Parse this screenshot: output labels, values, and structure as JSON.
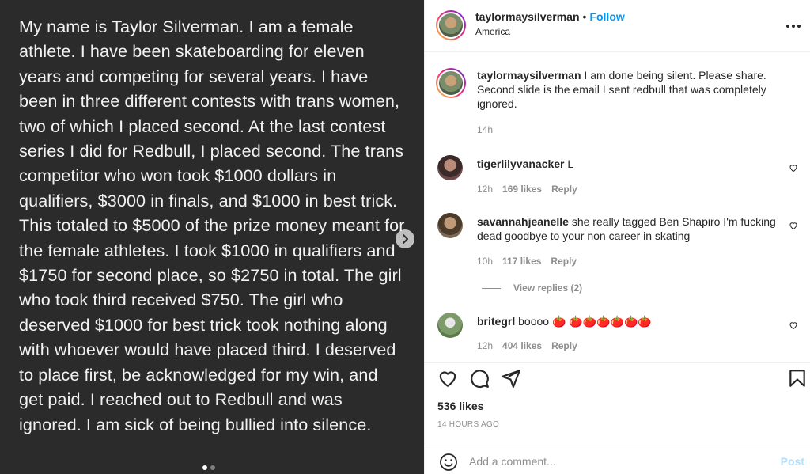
{
  "media": {
    "text": "My name is Taylor Silverman. I am a female athlete. I have been skateboarding for eleven years and competing for several years. I have been in three different contests with trans women, two of which I placed second. At the last contest series I did for Redbull, I placed second. The trans competitor who won took $1000 dollars in qualifiers, $3000 in finals, and $1000 in best trick. This totaled to $5000 of the prize money meant for the female athletes. I took $1000 in qualifiers and $1750 for second place, so $2750 in total. The girl who took third received $750. The girl who deserved $1000 for best trick took nothing along with whoever would have placed third. I deserved to place first, be acknowledged for my win, and get paid. I reached out to Redbull and was ignored. I am sick of being bullied into silence."
  },
  "header": {
    "username": "taylormaysilverman",
    "separator": "•",
    "follow_label": "Follow",
    "location": "America",
    "more_icon": "more-horizontal-icon"
  },
  "caption": {
    "username": "taylormaysilverman",
    "text": "I am done being silent. Please share. Second slide is the email I sent redbull that was completely ignored.",
    "time": "14h"
  },
  "comments": [
    {
      "username": "tigerlilyvanacker",
      "text": "L",
      "time": "12h",
      "likes": "169 likes",
      "reply": "Reply"
    },
    {
      "username": "savannahjeanelle",
      "text": "she really tagged Ben Shapiro I'm fucking dead goodbye to your non career in skating",
      "time": "10h",
      "likes": "117 likes",
      "reply": "Reply",
      "view_replies": "View replies (2)"
    },
    {
      "username": "britegrl",
      "text": "boooo 🍅 🍅🍅🍅🍅🍅🍅",
      "time": "12h",
      "likes": "404 likes",
      "reply": "Reply"
    }
  ],
  "actions": {
    "likes": "536 likes",
    "timestamp": "14 HOURS AGO"
  },
  "add_comment": {
    "placeholder": "Add a comment...",
    "post_label": "Post"
  },
  "colors": {
    "accent": "#0095f6",
    "media_bg": "#2b2b2b",
    "muted": "#8e8e8e"
  }
}
